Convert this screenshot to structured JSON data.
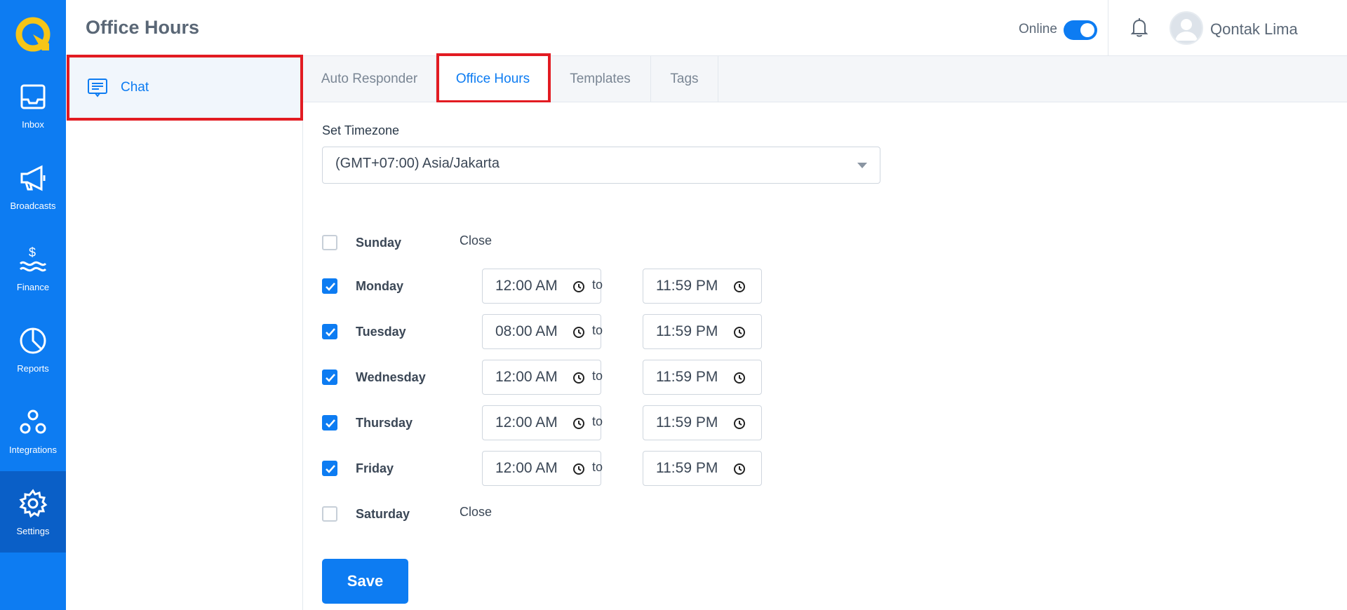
{
  "header": {
    "title": "Office Hours",
    "status_label": "Online",
    "status_on": true,
    "user_name": "Qontak Lima"
  },
  "rail": {
    "items": [
      {
        "label": "Inbox",
        "icon": "inbox-icon"
      },
      {
        "label": "Broadcasts",
        "icon": "megaphone-icon"
      },
      {
        "label": "Finance",
        "icon": "finance-icon"
      },
      {
        "label": "Reports",
        "icon": "pie-chart-icon"
      },
      {
        "label": "Integrations",
        "icon": "integrations-icon"
      },
      {
        "label": "Settings",
        "icon": "gear-icon",
        "active": true
      }
    ]
  },
  "subnav": {
    "items": [
      {
        "label": "Chat",
        "icon": "chat-icon",
        "active": true
      }
    ]
  },
  "tabs": [
    {
      "label": "Auto Responder"
    },
    {
      "label": "Office Hours",
      "active": true
    },
    {
      "label": "Templates"
    },
    {
      "label": "Tags"
    }
  ],
  "timezone": {
    "label": "Set Timezone",
    "value": "(GMT+07:00) Asia/Jakarta"
  },
  "schedule": {
    "to_label": "to",
    "close_label": "Close",
    "days": [
      {
        "name": "Sunday",
        "enabled": false
      },
      {
        "name": "Monday",
        "enabled": true,
        "from": "12:00 AM",
        "to": "11:59 PM"
      },
      {
        "name": "Tuesday",
        "enabled": true,
        "from": "08:00 AM",
        "to": "11:59 PM"
      },
      {
        "name": "Wednesday",
        "enabled": true,
        "from": "12:00 AM",
        "to": "11:59 PM"
      },
      {
        "name": "Thursday",
        "enabled": true,
        "from": "12:00 AM",
        "to": "11:59 PM"
      },
      {
        "name": "Friday",
        "enabled": true,
        "from": "12:00 AM",
        "to": "11:59 PM"
      },
      {
        "name": "Saturday",
        "enabled": false
      }
    ]
  },
  "actions": {
    "save_label": "Save"
  },
  "colors": {
    "primary": "#0d7cf2",
    "rail_active": "#0a5fc7",
    "highlight": "#e21b22",
    "logo": "#f5c518"
  }
}
